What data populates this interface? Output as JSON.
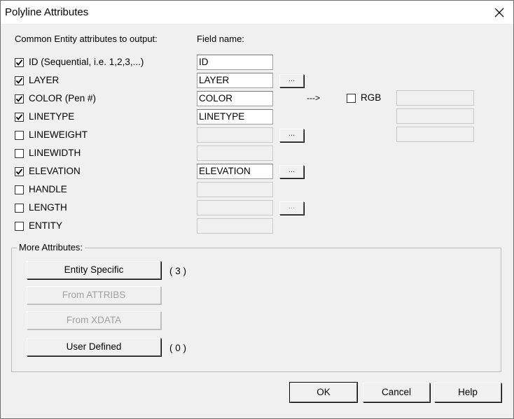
{
  "window": {
    "title": "Polyline Attributes"
  },
  "headers": {
    "common": "Common Entity attributes to output:",
    "field_name": "Field name:"
  },
  "rows": [
    {
      "label": "ID (Sequential, i.e. 1,2,3,...)",
      "checked": true,
      "field": "ID",
      "enabled": true,
      "browse": false
    },
    {
      "label": "LAYER",
      "checked": true,
      "field": "LAYER",
      "enabled": true,
      "browse": true,
      "browse_enabled": true
    },
    {
      "label": "COLOR (Pen #)",
      "checked": true,
      "field": "COLOR",
      "enabled": true,
      "browse": false
    },
    {
      "label": "LINETYPE",
      "checked": true,
      "field": "LINETYPE",
      "enabled": true,
      "browse": false
    },
    {
      "label": "LINEWEIGHT",
      "checked": false,
      "field": "",
      "enabled": false,
      "browse": true,
      "browse_enabled": true
    },
    {
      "label": "LINEWIDTH",
      "checked": false,
      "field": "",
      "enabled": false,
      "browse": false
    },
    {
      "label": "ELEVATION",
      "checked": true,
      "field": "ELEVATION",
      "enabled": true,
      "browse": true,
      "browse_enabled": true
    },
    {
      "label": "HANDLE",
      "checked": false,
      "field": "",
      "enabled": false,
      "browse": false
    },
    {
      "label": "LENGTH",
      "checked": false,
      "field": "",
      "enabled": false,
      "browse": true,
      "browse_enabled": false
    },
    {
      "label": "ENTITY",
      "checked": false,
      "field": "",
      "enabled": false,
      "browse": false
    }
  ],
  "browse_label": "...",
  "color_arrow": "--->",
  "rgb": {
    "label": "RGB",
    "checked": false,
    "fields": [
      "",
      "",
      ""
    ]
  },
  "more_attributes": {
    "title": "More Attributes:",
    "buttons": [
      {
        "label": "Entity Specific",
        "enabled": true,
        "count": "( 3 )"
      },
      {
        "label": "From ATTRIBS",
        "enabled": false,
        "count": ""
      },
      {
        "label": "From XDATA",
        "enabled": false,
        "count": ""
      },
      {
        "label": "User Defined",
        "enabled": true,
        "count": "( 0 )"
      }
    ]
  },
  "dialog_buttons": {
    "ok": "OK",
    "cancel": "Cancel",
    "help": "Help"
  },
  "icons": {
    "close": "close-icon",
    "check": "checkmark-icon"
  }
}
